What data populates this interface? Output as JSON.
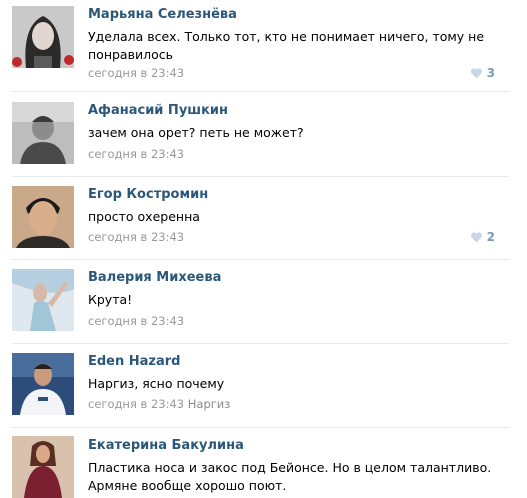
{
  "comments": [
    {
      "author": "Марьяна Селезнёва",
      "text": "Уделала всех. Только тот, кто не понимает ничего, тому не понравилось",
      "time": "сегодня в 23:43",
      "likes": "3"
    },
    {
      "author": "Афанасий Пушкин",
      "text": "зачем она орет? петь не может?",
      "time": "сегодня в 23:43"
    },
    {
      "author": "Егор Костромин",
      "text": "просто охеренна",
      "time": "сегодня в 23:43",
      "likes": "2"
    },
    {
      "author": "Валерия Михеева",
      "text": "Крута!",
      "time": "сегодня в 23:43"
    },
    {
      "author": "Eden Hazard",
      "text": "Наргиз, ясно почему",
      "time": "сегодня в 23:43",
      "reply_to": "Наргиз"
    },
    {
      "author": "Екатерина Бакулина",
      "text": "Пластика носа и закос под Бейонсе. Но в целом талантливо. Армяне вообще хорошо поют."
    }
  ],
  "colors": {
    "author": "#2b587a",
    "meta": "#999999",
    "like": "#7d9bb9"
  }
}
